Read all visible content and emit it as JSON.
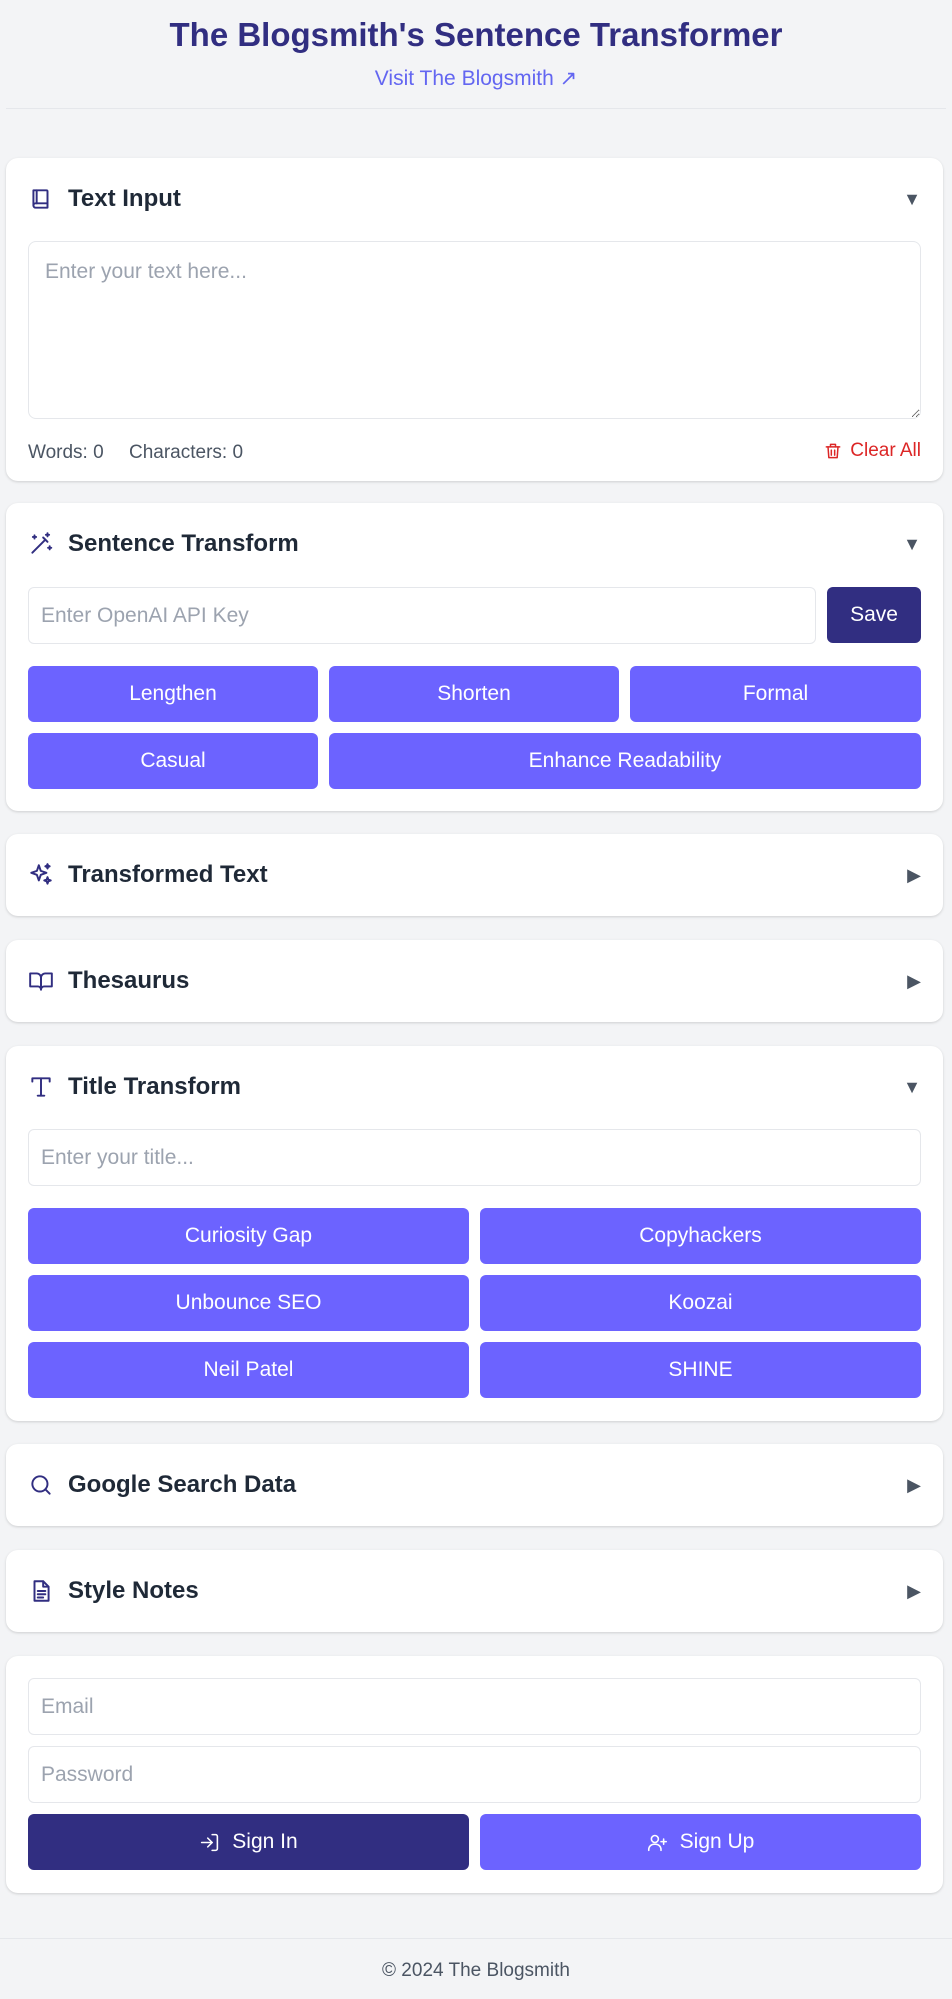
{
  "header": {
    "title": "The Blogsmith's Sentence Transformer",
    "visit_link": "Visit The Blogsmith ↗"
  },
  "text_input": {
    "title": "Text Input",
    "toggle": "▼",
    "placeholder": "Enter your text here...",
    "words_label": "Words: 0",
    "characters_label": "Characters: 0",
    "clear_label": "Clear All"
  },
  "sentence_transform": {
    "title": "Sentence Transform",
    "toggle": "▼",
    "api_placeholder": "Enter OpenAI API Key",
    "save_label": "Save",
    "buttons": [
      "Lengthen",
      "Shorten",
      "Formal",
      "Casual",
      "Enhance Readability"
    ]
  },
  "transformed_text": {
    "title": "Transformed Text",
    "toggle": "▶"
  },
  "thesaurus": {
    "title": "Thesaurus",
    "toggle": "▶"
  },
  "title_transform": {
    "title": "Title Transform",
    "toggle": "▼",
    "placeholder": "Enter your title...",
    "buttons": [
      "Curiosity Gap",
      "Copyhackers",
      "Unbounce SEO",
      "Koozai",
      "Neil Patel",
      "SHINE"
    ]
  },
  "google_search": {
    "title": "Google Search Data",
    "toggle": "▶"
  },
  "style_notes": {
    "title": "Style Notes",
    "toggle": "▶"
  },
  "auth": {
    "email_placeholder": "Email",
    "password_placeholder": "Password",
    "sign_in_label": "Sign In",
    "sign_up_label": "Sign Up"
  },
  "footer": {
    "text": "© 2024 The Blogsmith"
  },
  "colors": {
    "primary": "#6c63ff",
    "dark": "#312e81",
    "danger": "#dc2626",
    "background": "#f3f4f6"
  }
}
